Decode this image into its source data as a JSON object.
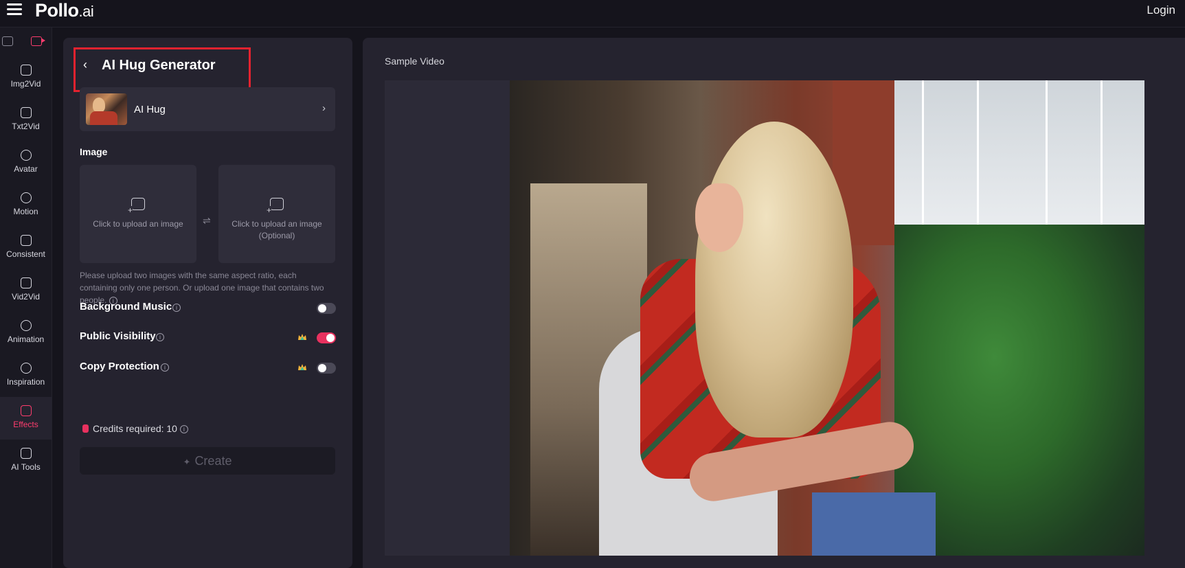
{
  "header": {
    "logo_main": "Pollo",
    "logo_suffix": ".ai",
    "login_label": "Login"
  },
  "rail": {
    "items": [
      {
        "label": "Img2Vid",
        "icon": "image-to-video-icon"
      },
      {
        "label": "Txt2Vid",
        "icon": "text-to-video-icon"
      },
      {
        "label": "Avatar",
        "icon": "avatar-icon"
      },
      {
        "label": "Motion",
        "icon": "motion-icon"
      },
      {
        "label": "Consistent",
        "icon": "consistent-icon"
      },
      {
        "label": "Vid2Vid",
        "icon": "video-to-video-icon"
      },
      {
        "label": "Animation",
        "icon": "animation-icon"
      },
      {
        "label": "Inspiration",
        "icon": "compass-icon"
      },
      {
        "label": "Effects",
        "icon": "effects-icon",
        "active": true
      },
      {
        "label": "AI Tools",
        "icon": "ai-tools-icon"
      }
    ]
  },
  "panel": {
    "back_icon": "‹",
    "title": "AI Hug Generator",
    "effect": {
      "name": "AI Hug",
      "chevron": "›"
    },
    "image_section": "Image",
    "upload1": "Click to upload an image",
    "upload2_line1": "Click to upload an image",
    "upload2_line2": "(Optional)",
    "swap_icon": "⇌",
    "help_text": "Please upload two images with the same aspect ratio, each containing only one person. Or upload one image that contains two people.",
    "options": [
      {
        "label": "Background Music",
        "on": false,
        "premium": false
      },
      {
        "label": "Public Visibility",
        "on": true,
        "premium": true
      },
      {
        "label": "Copy Protection",
        "on": false,
        "premium": true
      }
    ],
    "credits_label": "Credits required: 10",
    "create_label": "Create"
  },
  "preview": {
    "label": "Sample Video"
  },
  "colors": {
    "accent": "#e8315f",
    "highlight_box": "#e4222f",
    "panel_bg": "#25232f",
    "page_bg": "#15141c"
  }
}
